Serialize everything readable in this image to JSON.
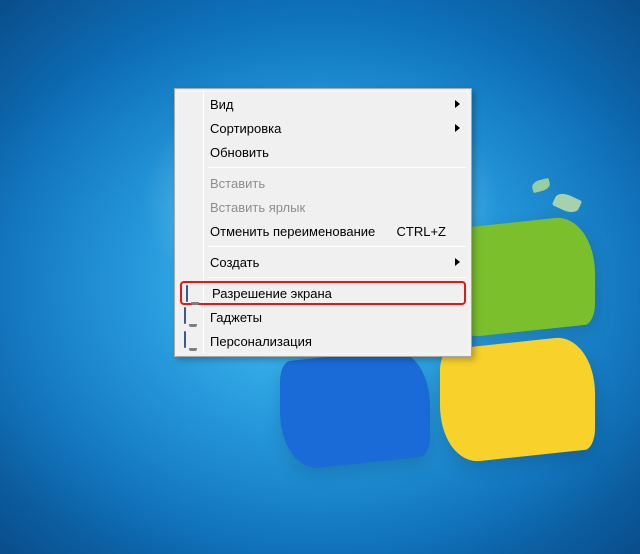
{
  "menu": {
    "view": {
      "label": "Вид",
      "hasSubmenu": true
    },
    "sort": {
      "label": "Сортировка",
      "hasSubmenu": true
    },
    "refresh": {
      "label": "Обновить"
    },
    "paste": {
      "label": "Вставить"
    },
    "pasteShort": {
      "label": "Вставить ярлык"
    },
    "undo": {
      "label": "Отменить переименование",
      "shortcut": "CTRL+Z"
    },
    "new": {
      "label": "Создать",
      "hasSubmenu": true
    },
    "resolution": {
      "label": "Разрешение экрана"
    },
    "gadgets": {
      "label": "Гаджеты"
    },
    "personalize": {
      "label": "Персонализация"
    }
  },
  "highlighted_item": "resolution"
}
